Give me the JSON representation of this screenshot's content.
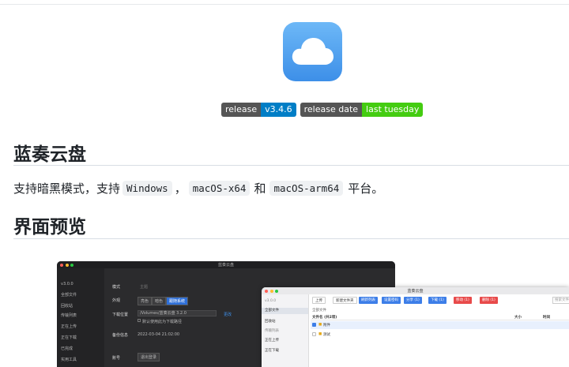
{
  "badges": [
    {
      "label": "release",
      "value": "v3.4.6",
      "color": "#007ec6"
    },
    {
      "label": "release date",
      "value": "last tuesday",
      "color": "#44cc11"
    }
  ],
  "heading1": "蓝奏云盘",
  "paragraph": {
    "prefix": "支持暗黑模式，支持",
    "code1": "Windows",
    "sep": "，",
    "code2": "macOS-x64",
    "and": "和",
    "code3": "macOS-arm64",
    "suffix": "平台。"
  },
  "heading2": "界面预览",
  "dark_preview": {
    "title": "蓝奏云盘",
    "sidebar": [
      "v3.0.0",
      "全部文件",
      "回收站",
      "传输列表",
      "正在上传",
      "正在下载",
      "已完成",
      "实用工具"
    ],
    "rows": {
      "theme_label": "模式",
      "theme_value": "主题",
      "appearance_label": "外观",
      "appearance_options": [
        "亮色",
        "暗色",
        "跟随系统"
      ],
      "download_label": "下载位置",
      "download_path": "/Volumes/蓝奏云盘 3.2.0",
      "change_button": "更改",
      "download_checkbox": "默认使用此为下载路径",
      "backup_label": "备份信息",
      "backup_value": "2022-03-04 21:02:00",
      "account_label": "账号",
      "logout_button": "退出登录"
    }
  },
  "light_preview": {
    "title": "蓝奏云盘",
    "sidebar": [
      "v3.0.0",
      "全部文件",
      "回收站",
      "传输列表",
      "正在上传",
      "正在下载"
    ],
    "toolbar": [
      "上传",
      "新建文件夹",
      "刷新列表",
      "设置密码",
      "分享 (1)",
      "下载 (1)",
      "移动 (1)",
      "删除 (1)"
    ],
    "search_placeholder": "搜索文件",
    "breadcrumb": "全部文件",
    "table_headers": [
      "文件名 (共2项)",
      "大小",
      "时间"
    ],
    "files": [
      "附件",
      "测试"
    ]
  }
}
